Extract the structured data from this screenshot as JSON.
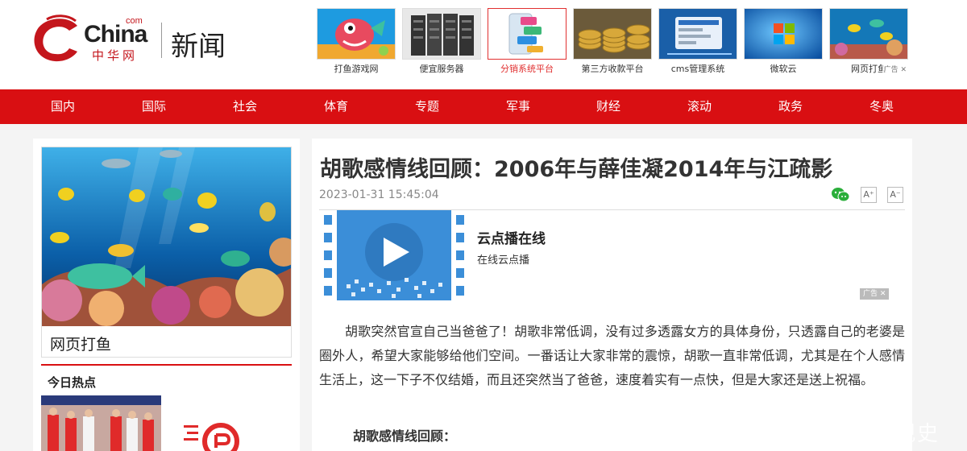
{
  "header": {
    "logo_word": "China",
    "logo_com": "com",
    "logo_cn": "中华网",
    "section": "新闻"
  },
  "ads": [
    {
      "caption": "打鱼游戏网",
      "icon": "fish-game-icon"
    },
    {
      "caption": "便宜服务器",
      "icon": "server-rack-icon"
    },
    {
      "caption": "分销系统平台",
      "icon": "distribution-platform-icon",
      "active": true
    },
    {
      "caption": "第三方收款平台",
      "icon": "coins-icon"
    },
    {
      "caption": "cms管理系统",
      "icon": "cms-screen-icon"
    },
    {
      "caption": "微软云",
      "icon": "windows-logo-icon"
    },
    {
      "caption": "网页打鱼",
      "icon": "reef-fish-icon"
    }
  ],
  "ad_mark": "广告",
  "nav": [
    "国内",
    "国际",
    "社会",
    "体育",
    "专题",
    "军事",
    "财经",
    "滚动",
    "政务",
    "冬奥"
  ],
  "sidebar": {
    "pic_title": "网页打鱼",
    "hot_title": "今日热点"
  },
  "article": {
    "title": "胡歌感情线回顾：2006年与薛佳凝2014年与江疏影",
    "date": "2023-01-31 15:45:04",
    "font_up": "A⁺",
    "font_down": "A⁻",
    "vod_title": "云点播在线",
    "vod_subtitle": "在线云点播",
    "vod_ad_tag": "广告 ✕",
    "paragraph": "胡歌突然官宣自己当爸爸了！胡歌非常低调，没有过多透露女方的具体身份，只透露自己的老婆是圈外人，希望大家能够给他们空间。一番话让大家非常的震惊，胡歌一直非常低调，尤其是在个人感情生活上，这一下子不仅结婚，而且还突然当了爸爸，速度着实有一点快，但是大家还是送上祝福。",
    "subheading": "胡歌感情线回顾："
  },
  "watermark": "观史",
  "colors": {
    "brand_red": "#d90f12",
    "active_ad_red": "#e13030"
  }
}
